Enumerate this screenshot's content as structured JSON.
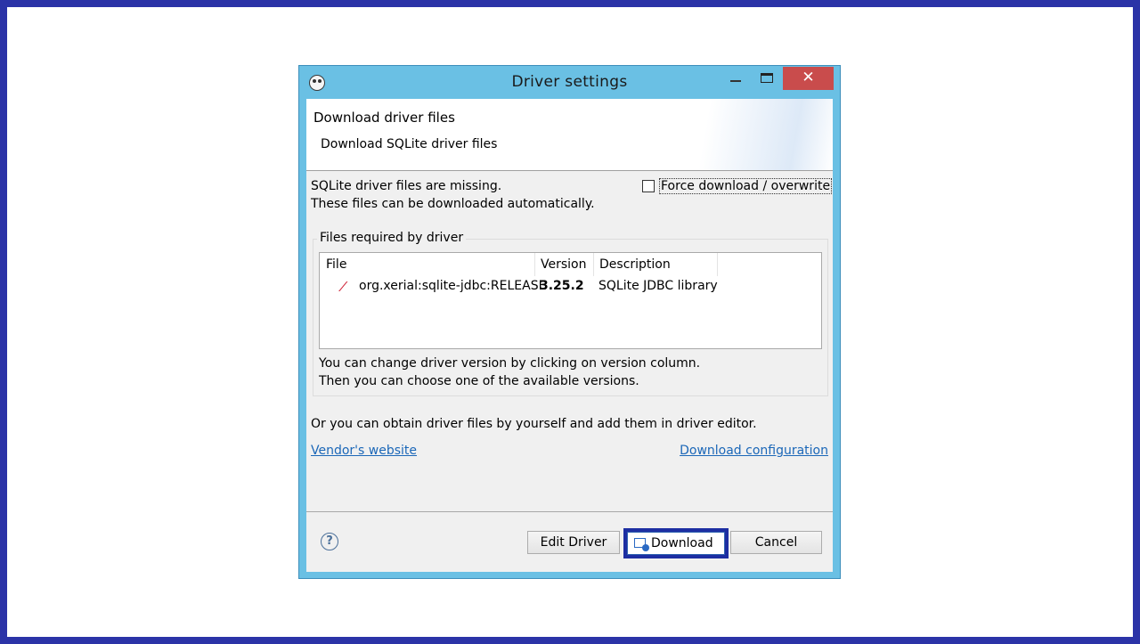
{
  "window": {
    "title": "Driver settings",
    "close_glyph": "✕",
    "app_icon": "dbeaver-beaver-icon"
  },
  "header": {
    "title": "Download driver files",
    "description": "Download SQLite driver files"
  },
  "body": {
    "missing_line1": "SQLite driver files are missing.",
    "missing_line2": "These files can be downloaded automatically.",
    "force_download_label": "Force download / overwrite",
    "force_download_checked": false
  },
  "files_group": {
    "label": "Files required by driver",
    "columns": [
      "File",
      "Version",
      "Description"
    ],
    "rows": [
      {
        "icon": "maven-feather-icon",
        "file": "org.xerial:sqlite-jdbc:RELEASE",
        "version": "3.25.2",
        "description": "SQLite JDBC library"
      }
    ],
    "hint_line1": "You can change driver version by clicking on version column.",
    "hint_line2": "Then you can choose one of the available versions."
  },
  "manual": {
    "text": "Or you can obtain driver files by yourself and add them in driver editor.",
    "vendor_link": "Vendor's website",
    "config_link": "Download configuration"
  },
  "footer": {
    "help_glyph": "?",
    "edit_driver": "Edit Driver",
    "download": "Download",
    "cancel": "Cancel"
  },
  "colors": {
    "frame": "#2b33a7",
    "titlebar": "#6ac0e4",
    "close_button": "#c94c4c",
    "link": "#1b67b8",
    "maven_icon": "#d0263a"
  }
}
